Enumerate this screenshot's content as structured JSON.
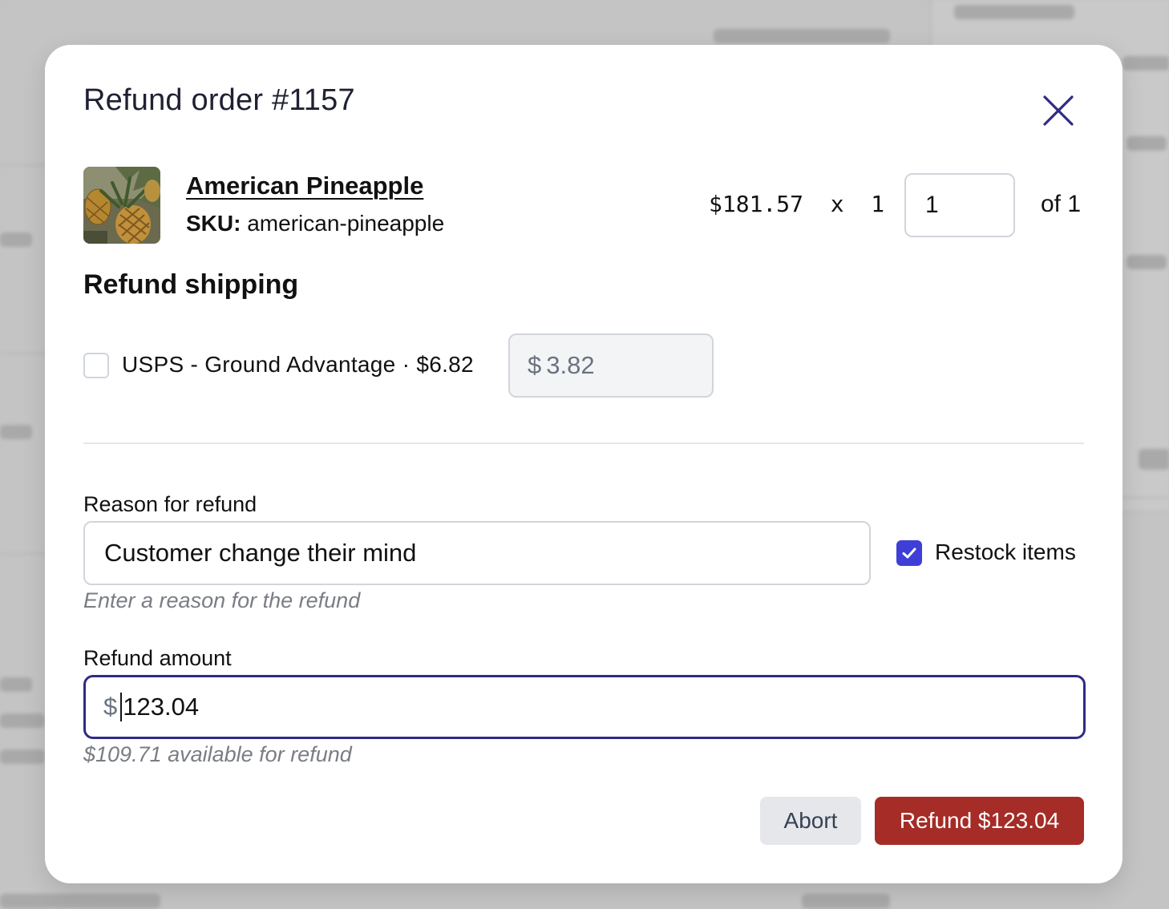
{
  "modal": {
    "title": "Refund order #1157",
    "close_icon": "close-icon"
  },
  "line_item": {
    "name": "American Pineapple",
    "sku_label": "SKU:",
    "sku_value": "american-pineapple",
    "price_line": "$181.57  x  1",
    "quantity_value": "1",
    "quantity_of": "of 1",
    "thumbnail_icon": "pineapple-image"
  },
  "shipping": {
    "section_title": "Refund shipping",
    "option_label": "USPS - Ground Advantage · $6.82",
    "option_checked": false,
    "currency_symbol": "$",
    "amount_placeholder": "3.82"
  },
  "reason": {
    "label": "Reason for refund",
    "value": "Customer change their mind",
    "hint": "Enter a reason for the refund"
  },
  "restock": {
    "label": "Restock items",
    "checked": true,
    "check_icon": "checkmark-icon"
  },
  "amount": {
    "label": "Refund amount",
    "currency_symbol": "$",
    "value": "123.04",
    "hint": "$109.71 available for refund"
  },
  "actions": {
    "abort_label": "Abort",
    "refund_label": "Refund $123.04"
  },
  "colors": {
    "accent": "#3f3fd8",
    "focus_border": "#2f2b86",
    "danger": "#a52c27",
    "close_icon": "#2f2b86"
  }
}
